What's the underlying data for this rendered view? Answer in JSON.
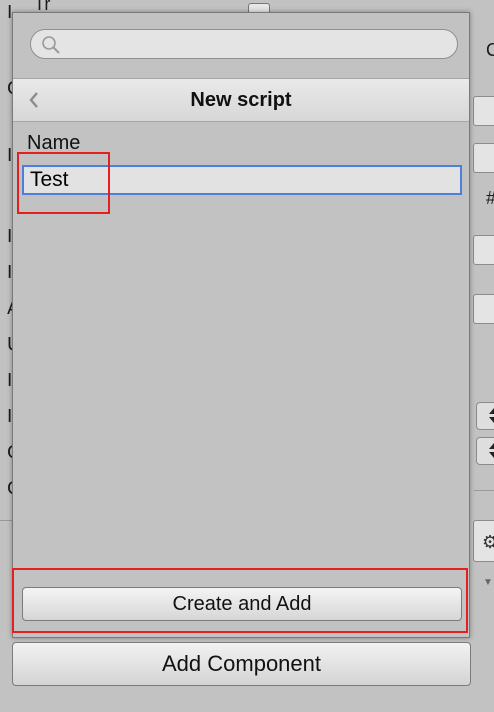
{
  "popup": {
    "search": {
      "placeholder": "",
      "value": ""
    },
    "header": {
      "title": "New script"
    },
    "form": {
      "name_label": "Name",
      "name_value": "Test"
    },
    "create_button_label": "Create and Add"
  },
  "add_component_label": "Add Component",
  "background": {
    "top_text": "Tr",
    "left_letters": [
      "I",
      "C",
      "I",
      "I",
      "I",
      "A",
      "U",
      "I",
      "I",
      "C",
      "C"
    ],
    "right_letters": [
      "C",
      "#"
    ]
  },
  "icons": {
    "search": "search-icon",
    "back": "chevron-left-icon",
    "stepper": "up-down-stepper-icon",
    "gear": "gear-icon"
  },
  "colors": {
    "panel": "#c2c2c2",
    "header": "#dcdcdc",
    "input_focus": "#4d7fdc",
    "highlight": "#e41f1f"
  }
}
